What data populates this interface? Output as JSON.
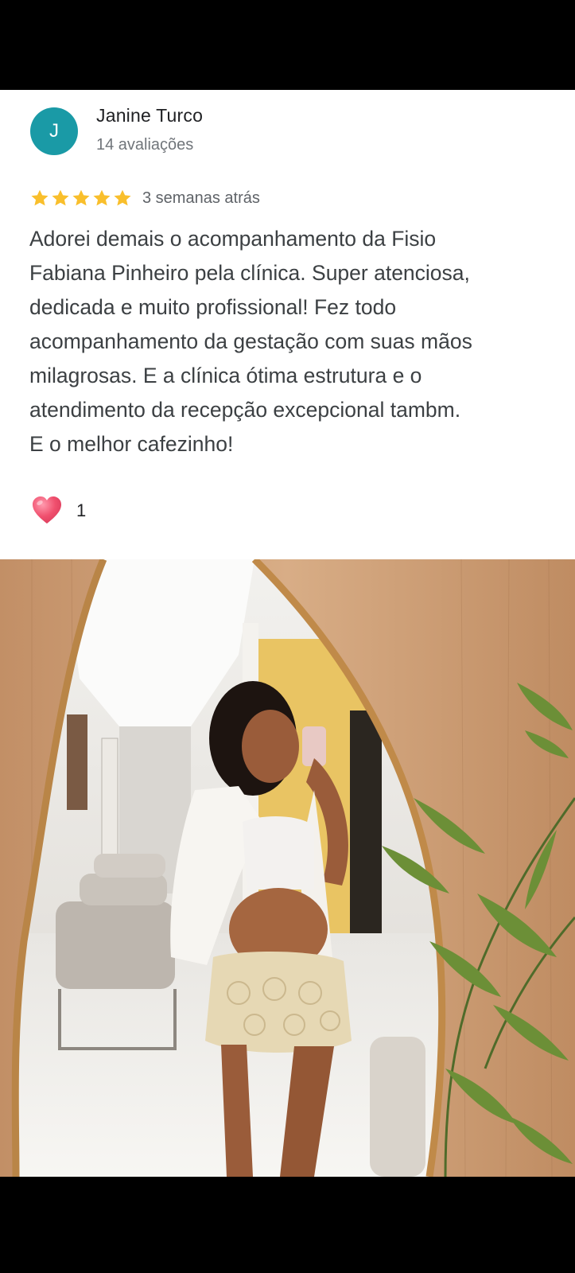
{
  "review": {
    "avatar_letter": "J",
    "author_name": "Janine Turco",
    "review_count": "14 avaliações",
    "rating": 5,
    "date": "3 semanas atrás",
    "text": "Adorei demais o acompanhamento da Fisio\nFabiana Pinheiro pela clínica. Super atenciosa,\ndedicada e muito profissional! Fez todo\nacompanhamento da gestação com suas mãos\nmilagrosas. E a clínica ótima estrutura e o\natendimento da recepção excepcional tambm.\nE o melhor cafezinho!",
    "reaction_count": "1"
  },
  "colors": {
    "avatar_bg": "#1a9aa6",
    "star": "#f9bf2c",
    "heart": "#f0506e"
  },
  "photo": {
    "icon": "review-photo"
  }
}
